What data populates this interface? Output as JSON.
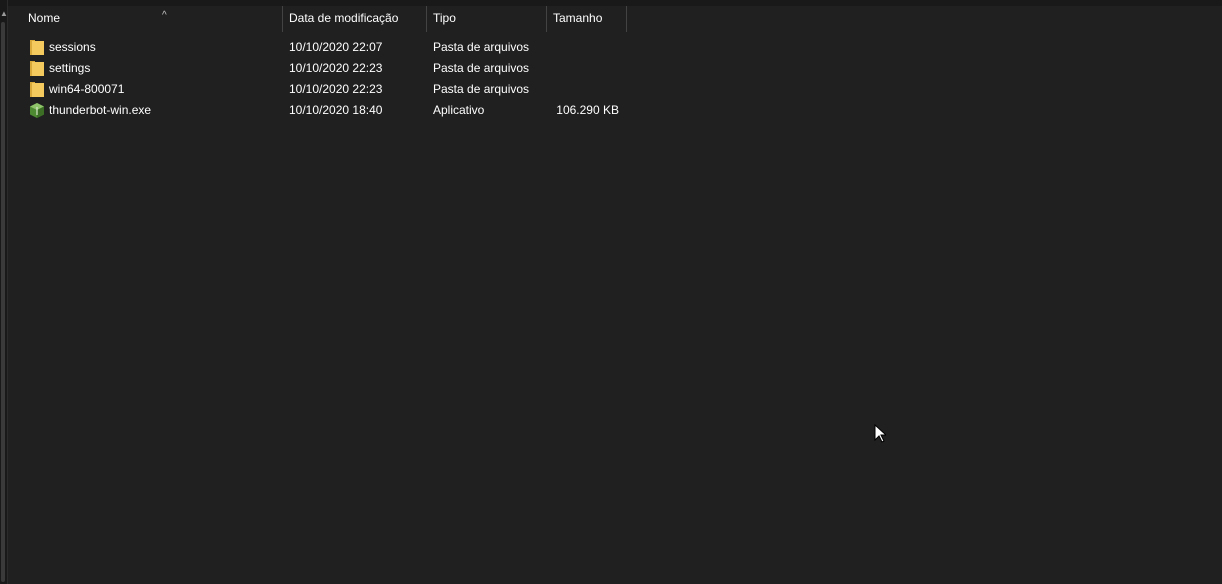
{
  "columns": {
    "name": "Nome",
    "date": "Data de modificação",
    "type": "Tipo",
    "size": "Tamanho"
  },
  "sort": {
    "column": "name",
    "direction": "ascending"
  },
  "files": [
    {
      "name": "sessions",
      "date": "10/10/2020 22:07",
      "type": "Pasta de arquivos",
      "size": "",
      "icon": "folder-icon"
    },
    {
      "name": "settings",
      "date": "10/10/2020 22:23",
      "type": "Pasta de arquivos",
      "size": "",
      "icon": "folder-icon"
    },
    {
      "name": "win64-800071",
      "date": "10/10/2020 22:23",
      "type": "Pasta de arquivos",
      "size": "",
      "icon": "folder-icon"
    },
    {
      "name": "thunderbot-win.exe",
      "date": "10/10/2020 18:40",
      "type": "Aplicativo",
      "size": "106.290 KB",
      "icon": "exe-app-icon"
    }
  ],
  "colors": {
    "background": "#202020",
    "folder": "#f4c95d",
    "app_icon": "#5a9a3c"
  }
}
